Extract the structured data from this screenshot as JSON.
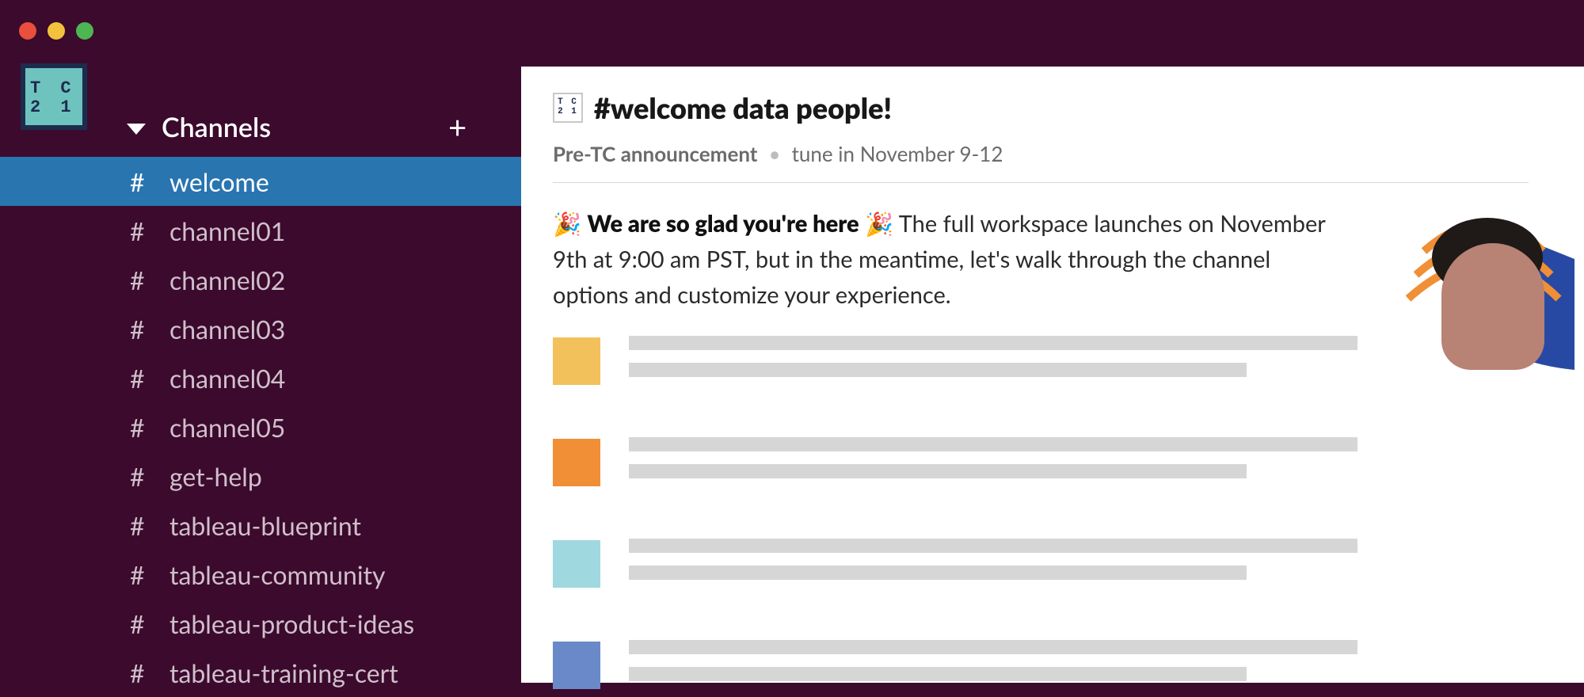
{
  "workspace_logo_text": "T C\n2 1",
  "mini_logo_text": "T C\n2 1",
  "sidebar": {
    "section_label": "Channels",
    "add_icon": "+",
    "channels": [
      {
        "name": "welcome",
        "active": true
      },
      {
        "name": "channel01",
        "active": false
      },
      {
        "name": "channel02",
        "active": false
      },
      {
        "name": "channel03",
        "active": false
      },
      {
        "name": "channel04",
        "active": false
      },
      {
        "name": "channel05",
        "active": false
      },
      {
        "name": "get-help",
        "active": false
      },
      {
        "name": "tableau-blueprint",
        "active": false
      },
      {
        "name": "tableau-community",
        "active": false
      },
      {
        "name": "tableau-product-ideas",
        "active": false
      },
      {
        "name": "tableau-training-cert",
        "active": false
      }
    ]
  },
  "channel_header": {
    "title": "#welcome data people!",
    "topic_primary": "Pre-TC announcement",
    "topic_separator": "•",
    "topic_secondary": "tune in November 9-12"
  },
  "welcome_message": {
    "emoji": "🎉",
    "bold_text": "We are so glad you're here",
    "rest_text": "The full workspace launches on November 9th at 9:00 am PST, but in the meantime, let's walk through the channel options and customize your experience."
  },
  "placeholder_blocks": [
    {
      "color": "#f3c15b"
    },
    {
      "color": "#f08f36"
    },
    {
      "color": "#9fd8de"
    },
    {
      "color": "#6a89c9"
    }
  ],
  "hero_image_alt": "Smiling person with orange and blue abstract background"
}
